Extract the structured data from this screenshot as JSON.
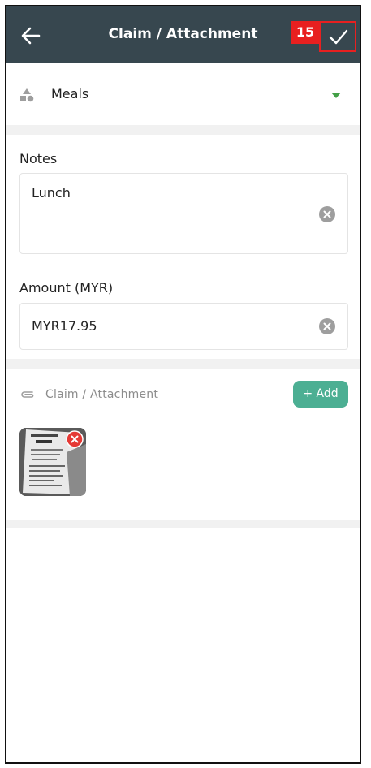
{
  "header": {
    "title": "Claim / Attachment",
    "badge": "15"
  },
  "category": {
    "label": "Meals",
    "icon": "shapes-icon"
  },
  "notes": {
    "label": "Notes",
    "value": "Lunch"
  },
  "amount": {
    "label": "Amount (MYR)",
    "value": "MYR17.95"
  },
  "attachments": {
    "label": "Claim / Attachment",
    "add_label": "+ Add",
    "items": [
      {
        "thumbnail": "receipt-thumbnail"
      }
    ]
  },
  "colors": {
    "header_bg": "#37474f",
    "accent_green": "#4caf93",
    "dropdown_green": "#43a047",
    "danger_red": "#e53935",
    "annotation_red": "#e82020"
  }
}
